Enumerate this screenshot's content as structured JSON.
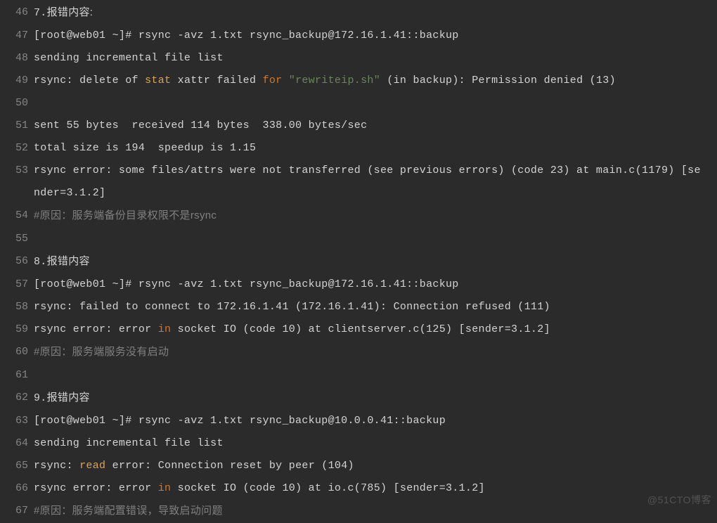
{
  "watermark": "@51CTO博客",
  "lines": [
    {
      "n": 46,
      "segs": [
        {
          "t": "7.",
          "cls": ""
        },
        {
          "t": "报错内容:",
          "cls": "cn"
        }
      ]
    },
    {
      "n": 47,
      "segs": [
        {
          "t": "[root@web01 ~]# rsync -avz 1.txt rsync_backup@172.16.1.41::backup",
          "cls": ""
        }
      ]
    },
    {
      "n": 48,
      "segs": [
        {
          "t": "sending incremental file list",
          "cls": ""
        }
      ]
    },
    {
      "n": 49,
      "segs": [
        {
          "t": "rsync: delete of ",
          "cls": ""
        },
        {
          "t": "stat",
          "cls": "t-func"
        },
        {
          "t": " xattr failed ",
          "cls": ""
        },
        {
          "t": "for",
          "cls": "t-kw"
        },
        {
          "t": " ",
          "cls": ""
        },
        {
          "t": "\"rewriteip.sh\"",
          "cls": "t-str"
        },
        {
          "t": " (in backup): Permission denied (13)",
          "cls": ""
        }
      ]
    },
    {
      "n": 50,
      "segs": []
    },
    {
      "n": 51,
      "segs": [
        {
          "t": "sent 55 bytes  received 114 bytes  338.00 bytes/sec",
          "cls": ""
        }
      ]
    },
    {
      "n": 52,
      "segs": [
        {
          "t": "total size is 194  speedup is 1.15",
          "cls": ""
        }
      ]
    },
    {
      "n": 53,
      "segs": [
        {
          "t": "rsync error: some files/attrs were not transferred (see previous errors) (code 23) at main.c(1179) [sender=3.1.2]",
          "cls": ""
        }
      ]
    },
    {
      "n": 54,
      "segs": [
        {
          "t": "#原因：服务端备份目录权限不是rsync",
          "cls": "t-cmt t-cmt-cn"
        }
      ]
    },
    {
      "n": 55,
      "segs": []
    },
    {
      "n": 56,
      "segs": [
        {
          "t": "8.",
          "cls": ""
        },
        {
          "t": "报错内容",
          "cls": "cn"
        }
      ]
    },
    {
      "n": 57,
      "segs": [
        {
          "t": "[root@web01 ~]# rsync -avz 1.txt rsync_backup@172.16.1.41::backup",
          "cls": ""
        }
      ]
    },
    {
      "n": 58,
      "segs": [
        {
          "t": "rsync: failed to connect to 172.16.1.41 (172.16.1.41): Connection refused (111)",
          "cls": ""
        }
      ]
    },
    {
      "n": 59,
      "segs": [
        {
          "t": "rsync error: error ",
          "cls": ""
        },
        {
          "t": "in",
          "cls": "t-kw"
        },
        {
          "t": " socket IO (code 10) at clientserver.c(125) [sender=3.1.2]",
          "cls": ""
        }
      ]
    },
    {
      "n": 60,
      "segs": [
        {
          "t": "#原因：服务端服务没有启动",
          "cls": "t-cmt t-cmt-cn"
        }
      ]
    },
    {
      "n": 61,
      "segs": []
    },
    {
      "n": 62,
      "segs": [
        {
          "t": "9.",
          "cls": ""
        },
        {
          "t": "报错内容",
          "cls": "cn"
        }
      ]
    },
    {
      "n": 63,
      "segs": [
        {
          "t": "[root@web01 ~]# rsync -avz 1.txt rsync_backup@10.0.0.41::backup",
          "cls": ""
        }
      ]
    },
    {
      "n": 64,
      "segs": [
        {
          "t": "sending incremental file list",
          "cls": ""
        }
      ]
    },
    {
      "n": 65,
      "segs": [
        {
          "t": "rsync: ",
          "cls": ""
        },
        {
          "t": "read",
          "cls": "t-func"
        },
        {
          "t": " error: Connection reset by peer (104)",
          "cls": ""
        }
      ]
    },
    {
      "n": 66,
      "segs": [
        {
          "t": "rsync error: error ",
          "cls": ""
        },
        {
          "t": "in",
          "cls": "t-kw"
        },
        {
          "t": " socket IO (code 10) at io.c(785) [sender=3.1.2]",
          "cls": ""
        }
      ]
    },
    {
      "n": 67,
      "segs": [
        {
          "t": "#原因：服务端配置错误，导致启动问题",
          "cls": "t-cmt t-cmt-cn"
        }
      ]
    }
  ]
}
